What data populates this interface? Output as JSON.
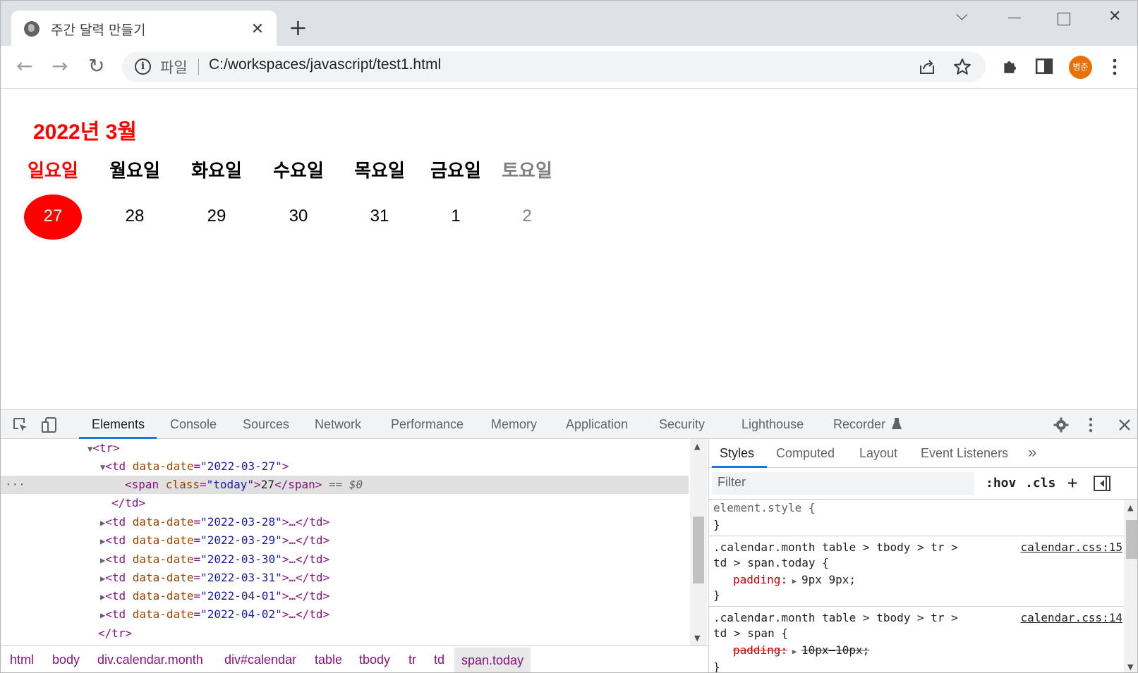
{
  "browser": {
    "tab_title": "주간 달력 만들기",
    "tab_close": "✕",
    "new_tab": "+",
    "window_controls": {
      "dropdown": "⌵",
      "close": "✕"
    },
    "nav": {
      "back": "←",
      "forward": "→",
      "reload": "↻"
    },
    "omnibox": {
      "scheme_label": "파일",
      "url": "C:/workspaces/javascript/test1.html"
    },
    "profile_initials": "병준",
    "icons": [
      "share-icon",
      "bookmark-star-icon",
      "extensions-puzzle-icon",
      "side-panel-icon",
      "more-vert-icon"
    ]
  },
  "calendar": {
    "title": "2022년 3월",
    "day_names": [
      "일요일",
      "월요일",
      "화요일",
      "수요일",
      "목요일",
      "금요일",
      "토요일"
    ],
    "dates": [
      "27",
      "28",
      "29",
      "30",
      "31",
      "1",
      "2"
    ],
    "today": "27",
    "colors": {
      "sunday": "#ff0000",
      "saturday": "#808080",
      "today_bg": "#ff0000",
      "weekday": "#000000"
    }
  },
  "devtools": {
    "tabs": [
      "Elements",
      "Console",
      "Sources",
      "Network",
      "Performance",
      "Memory",
      "Application",
      "Security",
      "Lighthouse",
      "Recorder"
    ],
    "active_tab": "Elements",
    "dom_lines": [
      {
        "tag_open": "<tr>"
      },
      {
        "tag_open": "<td ",
        "attr": "data-date",
        "value": "\"2022-03-27\"",
        "tag_end": ">"
      },
      {
        "tag_open": "<span ",
        "attr": "class",
        "value": "\"today\"",
        "tag_end": ">",
        "text": "27",
        "tag_close": "</span>",
        "marker": " == $0"
      },
      {
        "tag_close": "</td>"
      },
      {
        "tag_open": "<td ",
        "attr": "data-date",
        "value": "\"2022-03-28\"",
        "tag_end": ">…</td>"
      },
      {
        "tag_open": "<td ",
        "attr": "data-date",
        "value": "\"2022-03-29\"",
        "tag_end": ">…</td>"
      },
      {
        "tag_open": "<td ",
        "attr": "data-date",
        "value": "\"2022-03-30\"",
        "tag_end": ">…</td>"
      },
      {
        "tag_open": "<td ",
        "attr": "data-date",
        "value": "\"2022-03-31\"",
        "tag_end": ">…</td>"
      },
      {
        "tag_open": "<td ",
        "attr": "data-date",
        "value": "\"2022-04-01\"",
        "tag_end": ">…</td>"
      },
      {
        "tag_open": "<td ",
        "attr": "data-date",
        "value": "\"2022-04-02\"",
        "tag_end": ">…</td>"
      },
      {
        "tag_close": "</tr>"
      }
    ],
    "breadcrumbs": [
      "html",
      "body",
      "div.calendar.month",
      "div#calendar",
      "table",
      "tbody",
      "tr",
      "td",
      "span.today"
    ],
    "styles_tabs": [
      "Styles",
      "Computed",
      "Layout",
      "Event Listeners",
      "»"
    ],
    "filter_placeholder": "Filter",
    "filter_buttons": [
      ":hov",
      ".cls",
      "+"
    ],
    "rules": {
      "element_style_open": "element.style {",
      "element_style_close": "}",
      "rule1_selector_1": ".calendar.month table > tbody > tr >",
      "rule1_selector_2": "td > span.today {",
      "rule1_source": "calendar.css:15",
      "rule1_prop": "padding",
      "rule1_value": "9px 9px;",
      "rule1_close": "}",
      "rule2_selector_1": ".calendar.month table > tbody > tr >",
      "rule2_selector_2": "td > span {",
      "rule2_source": "calendar.css:14",
      "rule2_prop": "padding",
      "rule2_value": "10px—10px;",
      "rule2_close": "}"
    }
  }
}
